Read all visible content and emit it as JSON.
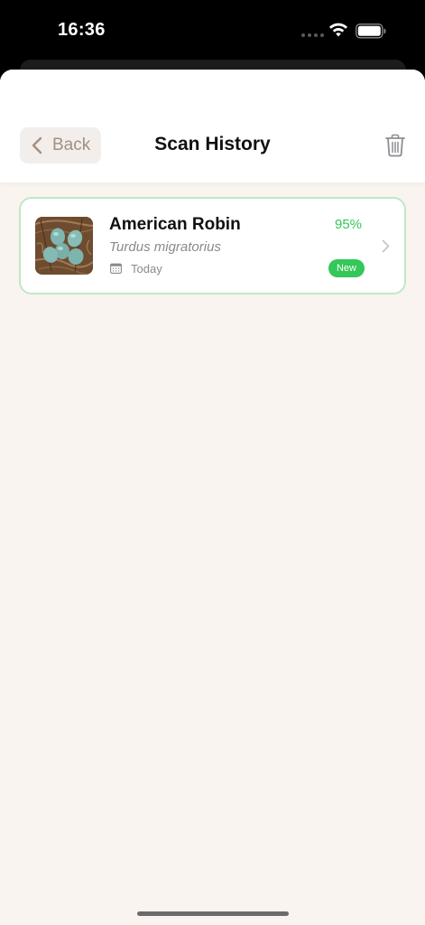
{
  "status_bar": {
    "time": "16:36",
    "icons": [
      "cellular-dots-icon",
      "wifi-icon",
      "battery-icon"
    ]
  },
  "header": {
    "back_label": "Back",
    "title": "Scan History",
    "trash_icon": "trash-icon"
  },
  "history": [
    {
      "name": "American Robin",
      "scientific_name": "Turdus migratorius",
      "date": "Today",
      "confidence": "95%",
      "badge": "New",
      "thumbnail": "robin-eggs-nest-photo"
    }
  ],
  "colors": {
    "accent_green": "#34c759",
    "card_border": "#bfe8c6",
    "back_text": "#a58f7f",
    "background": "#f9f4ef"
  }
}
